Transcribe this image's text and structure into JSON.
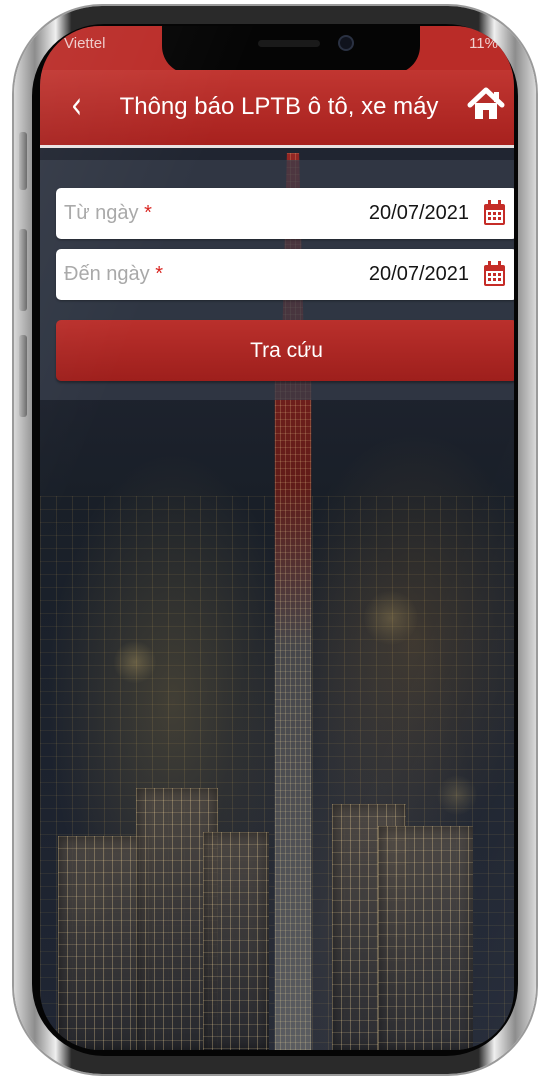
{
  "status": {
    "carrier": "Viettel",
    "battery": "11%"
  },
  "appbar": {
    "title": "Thông báo LPTB ô tô, xe máy",
    "back_icon": "chevron-left-icon",
    "home_icon": "home-icon"
  },
  "form": {
    "from_label": "Từ ngày",
    "to_label": "Đến ngày",
    "required_mark": "*",
    "from_value": "20/07/2021",
    "to_value": "20/07/2021",
    "calendar_icon": "calendar-icon",
    "search_label": "Tra cứu"
  },
  "colors": {
    "accent_red": "#b7292a",
    "background_overlay": "#363d4a",
    "white": "#ffffff"
  }
}
